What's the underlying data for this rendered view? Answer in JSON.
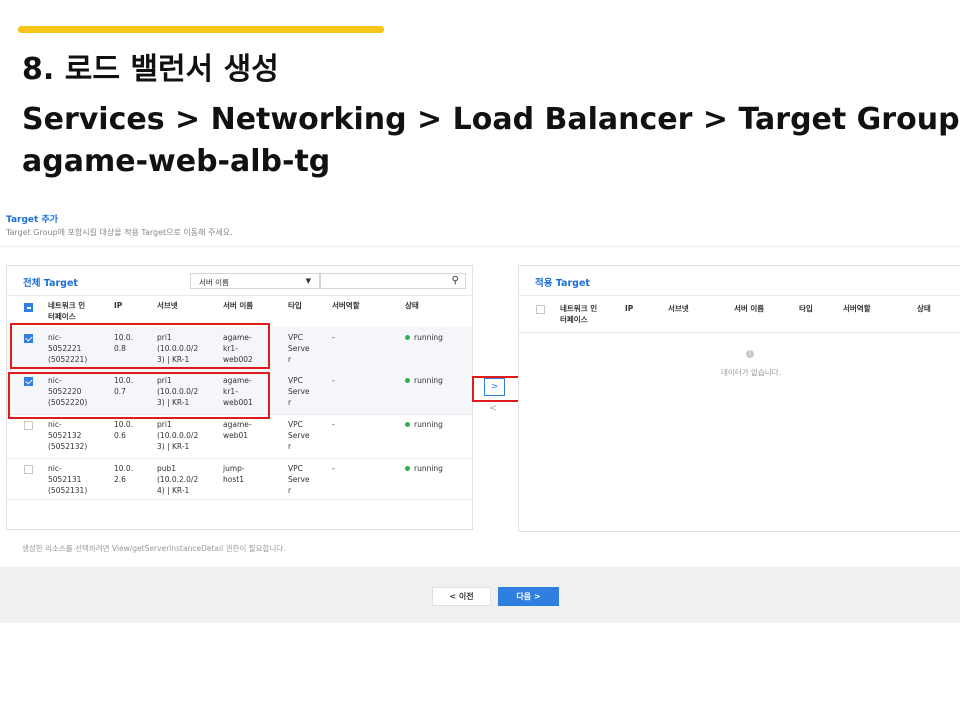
{
  "slide": {
    "title": "8. 로드 밸런서 생성",
    "path_line1": "Services > Networking > Load Balancer > Target Group",
    "path_line2": "agame-web-alb-tg"
  },
  "dialog": {
    "title": "Target 추가",
    "description": "Target Group에 포함시킬 대상을 적용 Target으로 이동해 주세요."
  },
  "left_panel": {
    "title": "전체 Target",
    "search_filter": "서버 이름",
    "columns": [
      "네트워크 인\n터페이스",
      "IP",
      "서브넷",
      "서버 이름",
      "타입",
      "서버역할",
      "상태"
    ],
    "rows": [
      {
        "nic": "nic-\n5052221\n(5052221)",
        "ip": "10.0.\n0.8",
        "subnet": "pri1\n(10.0.0.0/2\n3) | KR-1",
        "server": "agame-\nkr1-\nweb002",
        "type": "VPC\nServe\nr",
        "role": "-",
        "status": "running",
        "checked": true
      },
      {
        "nic": "nic-\n5052220\n(5052220)",
        "ip": "10.0.\n0.7",
        "subnet": "pri1\n(10.0.0.0/2\n3) | KR-1",
        "server": "agame-\nkr1-\nweb001",
        "type": "VPC\nServe\nr",
        "role": "-",
        "status": "running",
        "checked": true
      },
      {
        "nic": "nic-\n5052132\n(5052132)",
        "ip": "10.0.\n0.6",
        "subnet": "pri1\n(10.0.0.0/2\n3) | KR-1",
        "server": "agame-\nweb01",
        "type": "VPC\nServe\nr",
        "role": "-",
        "status": "running",
        "checked": false
      },
      {
        "nic": "nic-\n5052131\n(5052131)",
        "ip": "10.0.\n2.6",
        "subnet": "pub1\n(10.0.2.0/2\n4) | KR-1",
        "server": "jump-\nhost1",
        "type": "VPC\nServe\nr",
        "role": "-",
        "status": "running",
        "checked": false
      }
    ]
  },
  "right_panel": {
    "title": "적용 Target",
    "columns": [
      "네트워크 인\n터페이스",
      "IP",
      "서브넷",
      "서버 이름",
      "타입",
      "서버역할",
      "상태"
    ],
    "empty_text": "데이터가 없습니다.",
    "empty_icon": "!"
  },
  "transfer": {
    "move_right": ">",
    "move_left": "<"
  },
  "note": "생성한 리소스를 선택하려면 View/getServerInstanceDetail 권한이 필요합니다.",
  "footer": {
    "prev_label": "<  이전",
    "next_label": "다음  >"
  },
  "colors": {
    "accent": "#f5c518",
    "primary": "#2f7fe0",
    "highlight": "#e01b1b",
    "status_running": "#2bb24c"
  }
}
